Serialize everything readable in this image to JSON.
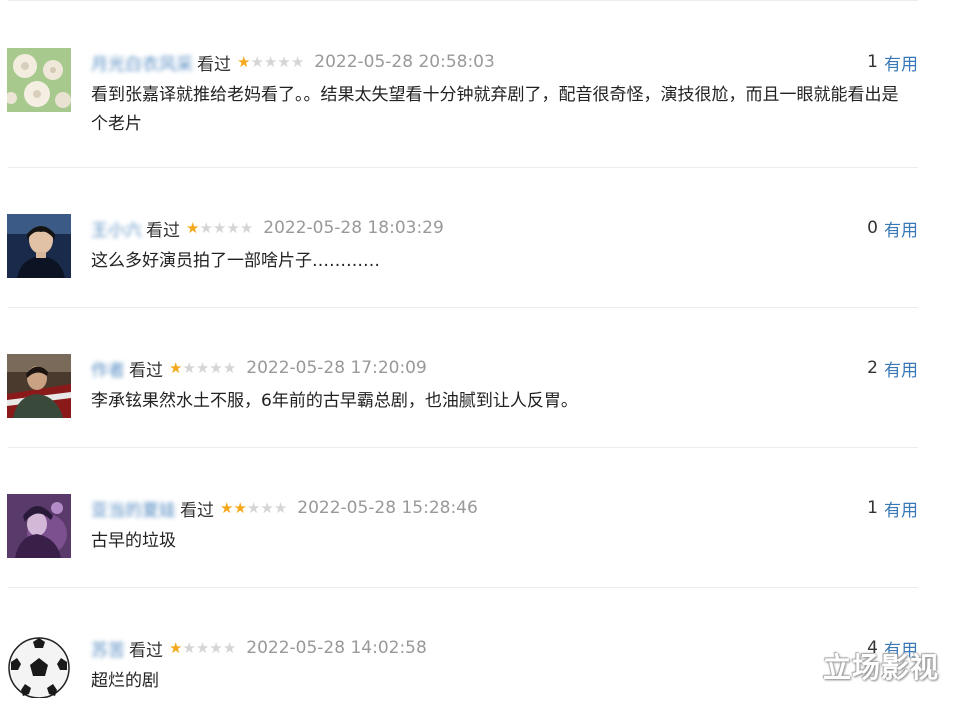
{
  "comments": [
    {
      "username": "月光白衣风采",
      "watched": "看过",
      "rating": 1,
      "time": "2022-05-28 20:58:03",
      "votes": "1",
      "vote_label": "有用",
      "text": "看到张嘉译就推给老妈看了。。结果太失望看十分钟就弃剧了，配音很奇怪，演技很尬，而且一眼就能看出是个老片"
    },
    {
      "username": "王小六",
      "watched": "看过",
      "rating": 1,
      "time": "2022-05-28 18:03:29",
      "votes": "0",
      "vote_label": "有用",
      "text": "这么多好演员拍了一部啥片子…………"
    },
    {
      "username": "作者",
      "watched": "看过",
      "rating": 1,
      "time": "2022-05-28 17:20:09",
      "votes": "2",
      "vote_label": "有用",
      "text": "李承铉果然水土不服，6年前的古早霸总剧，也油腻到让人反胃。"
    },
    {
      "username": "亚当的夏娃",
      "watched": "看过",
      "rating": 2,
      "time": "2022-05-28 15:28:46",
      "votes": "1",
      "vote_label": "有用",
      "text": "古早的垃圾"
    },
    {
      "username": "苏苦",
      "watched": "看过",
      "rating": 1,
      "time": "2022-05-28 14:02:58",
      "votes": "4",
      "vote_label": "有用",
      "text": "超烂的剧"
    }
  ],
  "watermark": "立场影视",
  "colors": {
    "link": "#3a79b8",
    "star_on": "#f4a91d",
    "star_off": "#d5d5d5",
    "time": "#999999",
    "divider": "#ececec"
  }
}
